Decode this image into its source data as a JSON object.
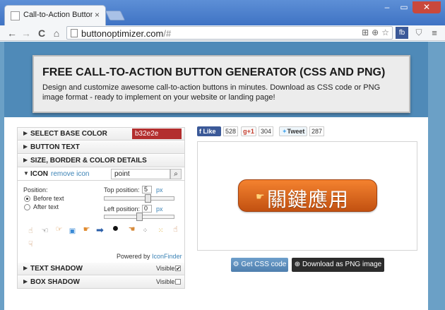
{
  "browser": {
    "tab_title": "Call-to-Action Button Ge",
    "tab_close": "×",
    "url_host": "buttonoptimizer.com",
    "url_path": "/#",
    "nav_back": "←",
    "nav_forward": "→",
    "nav_reload": "C",
    "nav_home": "⌂",
    "ext_fb": "fb",
    "win_min": "–",
    "win_max": "▭",
    "win_close": "✕"
  },
  "banner": {
    "title": "FREE CALL-TO-ACTION BUTTON GENERATOR (CSS AND PNG)",
    "description": "Design and customize awesome call-to-action buttons in minutes. Download as CSS code or PNG image format - ready to implement on your website or landing page!"
  },
  "panel": {
    "base_color_label": "SELECT BASE COLOR",
    "base_color_value": "b32e2e",
    "base_color_hex": "#b32e2e",
    "button_text_label": "BUTTON TEXT",
    "size_label": "SIZE, BORDER & COLOR DETAILS",
    "icon_label": "ICON",
    "remove_icon": "remove icon",
    "icon_search_value": "point",
    "position_label": "Position:",
    "before_text": "Before text",
    "after_text": "After text",
    "top_position_label": "Top position:",
    "top_position_value": "5",
    "left_position_label": "Left position:",
    "left_position_value": "0",
    "unit": "px",
    "powered_by": "Powered by",
    "iconfinder": "IconFinder",
    "text_shadow_label": "TEXT SHADOW",
    "box_shadow_label": "BOX SHADOW",
    "visible_label": "Visible",
    "text_shadow_checked": "✔",
    "box_shadow_checked": ""
  },
  "social": {
    "fb_like": "Like",
    "fb_count": "528",
    "gplus": "g+1",
    "gplus_count": "304",
    "tweet": "Tweet",
    "tweet_count": "287"
  },
  "preview": {
    "button_text": "關鍵應用",
    "button_color": "#e8702a"
  },
  "actions": {
    "get_css": "Get CSS code",
    "download_png": "Download as PNG image"
  }
}
